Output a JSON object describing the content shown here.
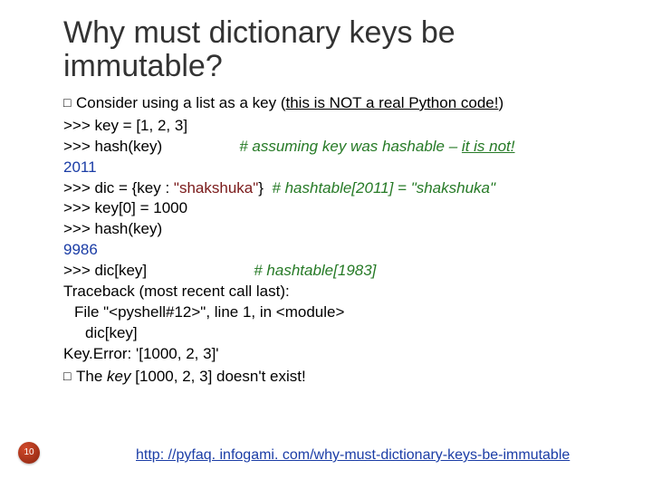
{
  "title": "Why must dictionary keys be immutable?",
  "bullets": {
    "first": "Consider using a list as a key (",
    "first_emph": "this is NOT a real Python code!",
    "first_tail": ")",
    "last_pre": "The ",
    "last_key": "key",
    "last_tail": " [1000, 2, 3] doesn't exist!"
  },
  "code": {
    "l1a": ">>> key = [1, 2, 3]",
    "l2a": ">>> hash(key)",
    "l2c_pre": "# assuming ",
    "l2c_key": "key",
    "l2c_post": " was hashable – ",
    "l2c_emph": "it is not!",
    "l3": "2011",
    "l4a": ">>> dic = {key : ",
    "l4q": "\"shakshuka\"",
    "l4b": "}",
    "l4c": "# hashtable[2011] = \"shakshuka\"",
    "l5": ">>> key[0] = 1000",
    "l6": ">>> hash(key)",
    "l7": "9986",
    "l8a": ">>> dic[key]",
    "l8c": "# hashtable[1983]",
    "l9": "Traceback (most recent call last):",
    "l10": "File \"<pyshell#12>\", line 1, in <module>",
    "l11": "dic[key]",
    "l12": "Key.Error: '[1000, 2, 3]'"
  },
  "footer": {
    "url": "http: //pyfaq. infogami. com/why-must-dictionary-keys-be-immutable"
  },
  "page": "10",
  "bullet_glyph": "□"
}
